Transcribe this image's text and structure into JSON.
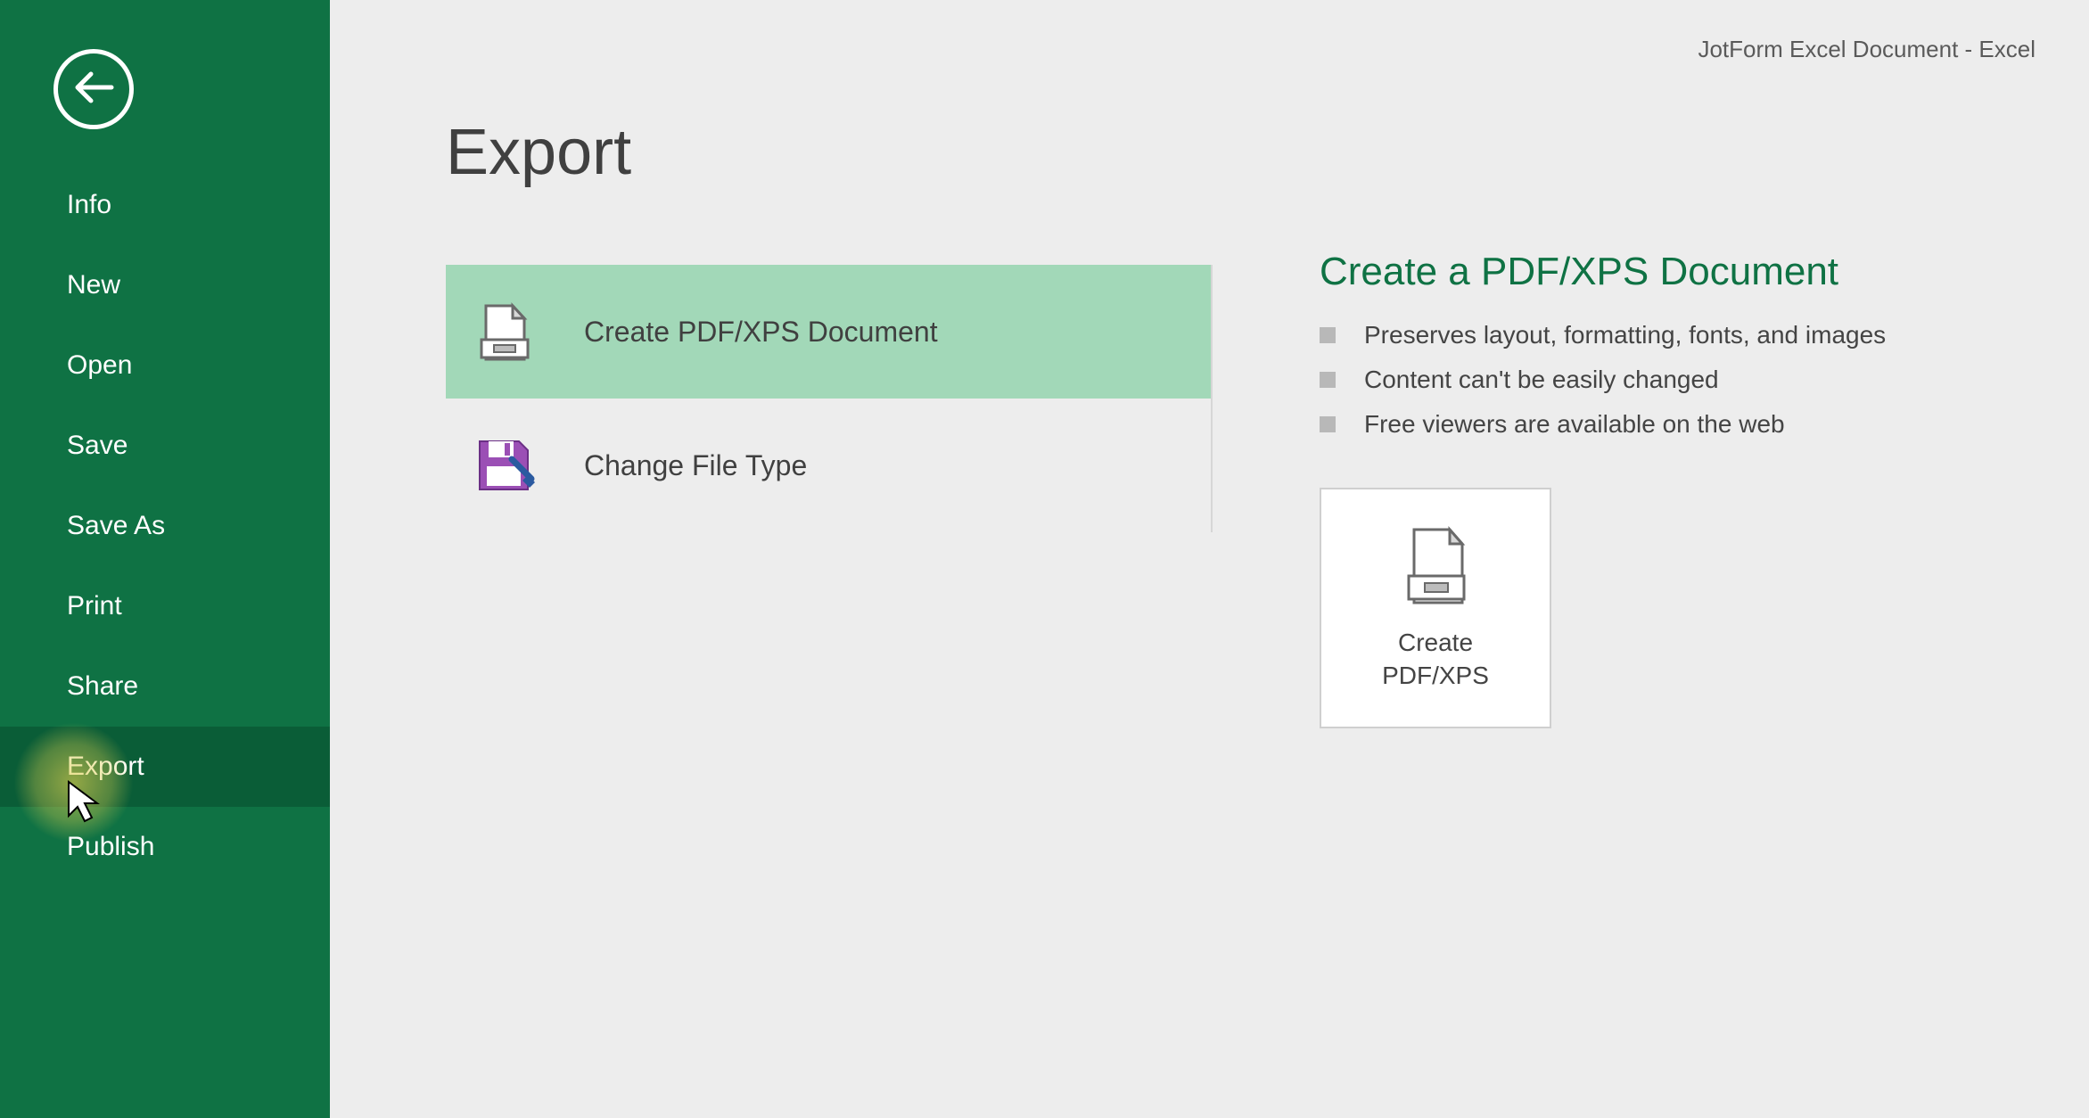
{
  "window": {
    "title": "JotForm Excel Document - Excel"
  },
  "sidebar": {
    "items": [
      {
        "label": "Info"
      },
      {
        "label": "New"
      },
      {
        "label": "Open"
      },
      {
        "label": "Save"
      },
      {
        "label": "Save As"
      },
      {
        "label": "Print"
      },
      {
        "label": "Share"
      },
      {
        "label": "Export"
      },
      {
        "label": "Publish"
      }
    ]
  },
  "page": {
    "heading": "Export",
    "options": [
      {
        "label": "Create PDF/XPS Document"
      },
      {
        "label": "Change File Type"
      }
    ],
    "details": {
      "heading": "Create a PDF/XPS Document",
      "bullets": [
        "Preserves layout, formatting, fonts, and images",
        "Content can't be easily changed",
        "Free viewers are available on the web"
      ],
      "action": {
        "line1": "Create",
        "line2": "PDF/XPS"
      }
    }
  }
}
